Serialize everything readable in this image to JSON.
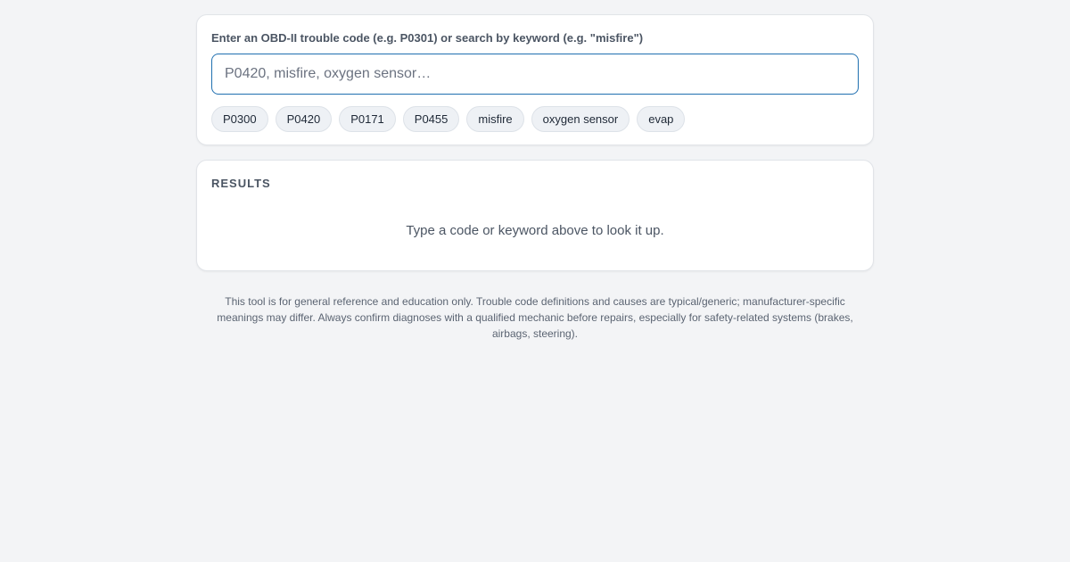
{
  "search": {
    "label": "Enter an OBD-II trouble code (e.g. P0301) or search by keyword (e.g. \"misfire\")",
    "placeholder": "P0420, misfire, oxygen sensor…",
    "value": "",
    "quick_chips": [
      "P0300",
      "P0420",
      "P0171",
      "P0455",
      "misfire",
      "oxygen sensor",
      "evap"
    ]
  },
  "results": {
    "heading": "RESULTS",
    "empty_message": "Type a code or keyword above to look it up."
  },
  "disclaimer": "This tool is for general reference and education only. Trouble code definitions and causes are typical/generic; manufacturer-specific meanings may differ. Always confirm diagnoses with a qualified mechanic before repairs, especially for safety-related systems (brakes, airbags, steering).",
  "colors": {
    "background": "#f3f4f6",
    "input_border_focus": "#1f6fb0",
    "chip_background": "#eef1f5"
  }
}
